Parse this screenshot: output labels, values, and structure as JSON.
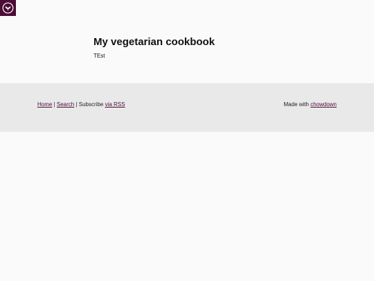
{
  "header": {
    "logo_icon": "leaf-bowl-icon",
    "logo_bg": "#4a0d36"
  },
  "main": {
    "title": "My vegetarian cookbook",
    "body_text": "TEst"
  },
  "footer": {
    "home_link": "Home",
    "sep1": " | ",
    "search_link": "Search",
    "sep2": " | ",
    "subscribe_text": "Subscribe ",
    "rss_link": "via RSS",
    "made_with_text": "Made with ",
    "chowdown_link": "chowdown"
  },
  "colors": {
    "page_bg": "#fafafa",
    "footer_bg": "#e9e9e9",
    "link": "#4a0d36"
  }
}
